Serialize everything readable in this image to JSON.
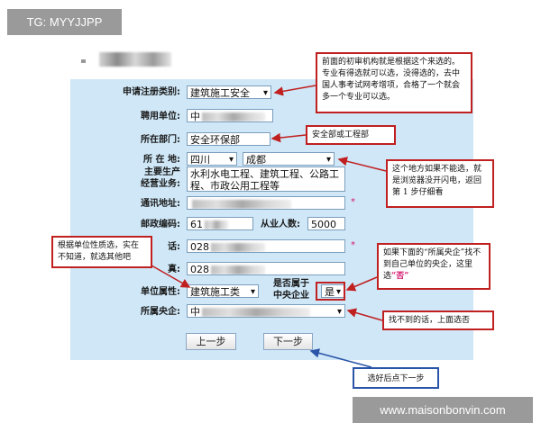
{
  "watermarks": {
    "top": "TG: MYYJJPP",
    "bottom": "www.maisonbonvin.com"
  },
  "form": {
    "category_label": "申请注册类别:",
    "category_value": "建筑施工安全",
    "employer_label": "聘用单位:",
    "employer_value": "中",
    "department_label": "所在部门:",
    "department_value": "安全环保部",
    "location_label": "所 在 地:",
    "province_value": "四川",
    "city_value": "成都",
    "business_label_1": "主要生产",
    "business_label_2": "经营业务:",
    "business_value": "水利水电工程、建筑工程、公路工程、市政公用工程等",
    "address_label": "通讯地址:",
    "address_value": "",
    "postcode_label": "邮政编码:",
    "postcode_value": "61",
    "staff_label": "从业人数:",
    "staff_value": "5000",
    "phone_label": "话:",
    "phone_value": "028",
    "fax_label": "真:",
    "fax_value": "028",
    "unit_type_label": "单位属性:",
    "unit_type_value": "建筑施工类",
    "central_label_1": "是否属于",
    "central_label_2": "中央企业",
    "central_value": "是",
    "central_enterprise_label": "所属央企:",
    "central_enterprise_value": "中",
    "required_mark": "*",
    "prev_button": "上一步",
    "next_button": "下一步"
  },
  "callouts": {
    "top": "前面的初审机构就是根据这个来选的。专业有得选就可以选，没得选的，去中国人事考试网考增项，合格了一个就会多一个专业可以选。",
    "department": "安全部或工程部",
    "location": "这个地方如果不能选，就是浏览器没开闪电，返回第 1 步仔细看",
    "unit_type": "根据单位性质选，实在不知道，就选其他吧",
    "central_pre": "如果下面的“所属央企”找不到自己单位的央企，这里选",
    "central_hl": "“否”",
    "not_found": "找不到的话，上面选否",
    "next": "选好后点下一步"
  },
  "colors": {
    "panel": "#cfe7f7",
    "callout_red": "#c02020",
    "callout_blue": "#2a55a8",
    "highlight": "#d4166b"
  }
}
